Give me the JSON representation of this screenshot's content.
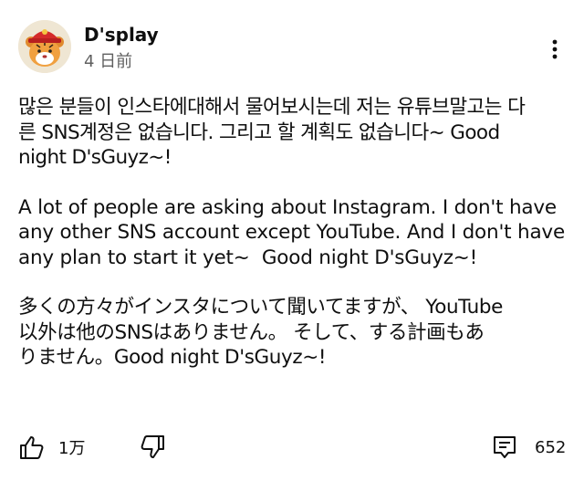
{
  "comment": {
    "author": "D'splay",
    "time": "4 日前",
    "paragraphs": {
      "korean": "많은 분들이 인스타에대해서 물어보시는데 저는 유튜브말고는 다\n른 SNS계정은 없습니다. 그리고 할 계획도 없습니다~ Good\nnight D'sGuyz~!",
      "english": "A lot of people are asking about Instagram. I don't have\nany other SNS account except YouTube. And I don't have\nany plan to start it yet~  Good night D'sGuyz~!",
      "japanese": "多くの方々がインスタについて聞いてますが、 YouTube\n以外は他のSNSはありません。 そして、する計画もあ\nりません。Good night D'sGuyz~!"
    },
    "likes": "1万",
    "replies": "652",
    "icons": {
      "avatar": "tiger-avatar",
      "more": "more-vert-icon",
      "like": "thumb-up-icon",
      "dislike": "thumb-down-icon",
      "reply": "comment-icon"
    },
    "colors": {
      "text": "#0f0f0f",
      "secondary": "#606060"
    }
  }
}
